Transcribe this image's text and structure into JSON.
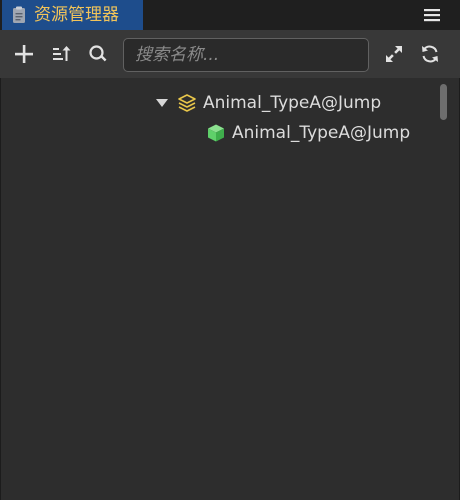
{
  "panel": {
    "tab_label": "资源管理器",
    "tab_icon": "clipboard-icon",
    "menu_icon": "hamburger-menu-icon",
    "accent_color": "#1e4d8c",
    "tab_label_color": "#f2c45a"
  },
  "toolbar": {
    "add_icon": "plus-icon",
    "sort_icon": "sort-icon",
    "search_icon": "search-icon",
    "search_placeholder": "搜索名称...",
    "expand_icon": "expand-icon",
    "refresh_icon": "refresh-icon"
  },
  "tree": {
    "items": [
      {
        "label": "Animal_TypeA@Jump",
        "icon": "layers-icon",
        "expanded": true,
        "icon_color": "#e8c64a"
      },
      {
        "label": "Animal_TypeA@Jump",
        "icon": "cube-icon",
        "icon_color": "#5fd06a"
      }
    ]
  }
}
